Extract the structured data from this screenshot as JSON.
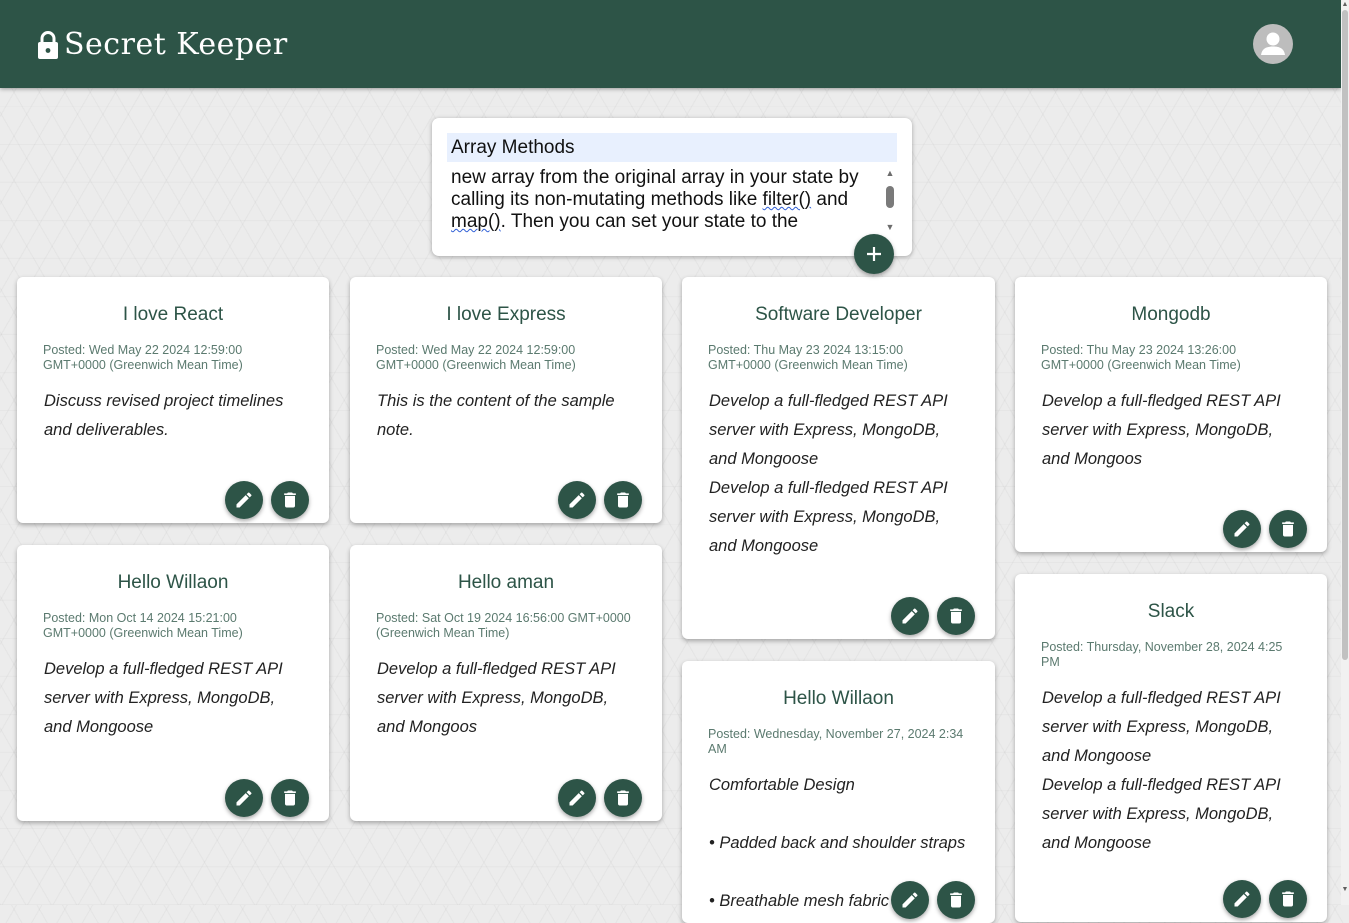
{
  "app": {
    "title": "Secret Keeper",
    "brand_color": "#2d5447",
    "icons": {
      "brand": "lock-icon",
      "account": "account-circle-icon",
      "add": "plus-icon",
      "edit": "pencil-icon",
      "delete": "trash-icon"
    }
  },
  "composer": {
    "title_value": "Array Methods",
    "content_lines": [
      [
        "new array from the original array in your state by"
      ],
      [
        "calling its non-mutating methods like ",
        {
          "code": "filter()"
        },
        " and"
      ],
      [
        {
          "code": "map()"
        },
        ". Then you can set your state to the"
      ]
    ]
  },
  "notes": [
    {
      "title": "I love React",
      "date": "Posted: Wed May 22 2024 12:59:00 GMT+0000 (Greenwich Mean Time)",
      "content": [
        "Discuss revised project timelines and deliverables."
      ]
    },
    {
      "title": "I love Express",
      "date": "Posted: Wed May 22 2024 12:59:00 GMT+0000 (Greenwich Mean Time)",
      "content": [
        "This is the content of the sample note."
      ]
    },
    {
      "title": "Software Developer",
      "date": "Posted: Thu May 23 2024 13:15:00 GMT+0000 (Greenwich Mean Time)",
      "content": [
        "Develop a full-fledged REST API server with Express, MongoDB, and Mongoose",
        "Develop a full-fledged REST API server with Express, MongoDB, and Mongoose"
      ]
    },
    {
      "title": "Mongodb",
      "date": "Posted: Thu May 23 2024 13:26:00 GMT+0000 (Greenwich Mean Time)",
      "content": [
        "Develop a full-fledged REST API server with Express, MongoDB, and Mongoos"
      ]
    },
    {
      "title": "Hello Willaon",
      "date": "Posted: Mon Oct 14 2024 15:21:00 GMT+0000 (Greenwich Mean Time)",
      "content": [
        "Develop a full-fledged REST API server with Express, MongoDB, and Mongoose"
      ]
    },
    {
      "title": "Hello aman",
      "date": "Posted: Sat Oct 19 2024 16:56:00 GMT+0000 (Greenwich Mean Time)",
      "content": [
        "Develop a full-fledged REST API server with Express, MongoDB, and Mongoos"
      ]
    },
    {
      "title": "Hello Willaon",
      "date": "Posted: Wednesday, November 27, 2024 2:34 AM",
      "content": [
        "Comfortable Design",
        "",
        "• Padded back and shoulder straps",
        "",
        "• Breathable mesh fabric"
      ]
    },
    {
      "title": "Slack",
      "date": "Posted: Thursday, November 28, 2024 4:25 PM",
      "content": [
        "Develop a full-fledged REST API server with Express, MongoDB, and Mongoose",
        "Develop a full-fledged REST API server with Express, MongoDB, and Mongoose"
      ]
    }
  ]
}
